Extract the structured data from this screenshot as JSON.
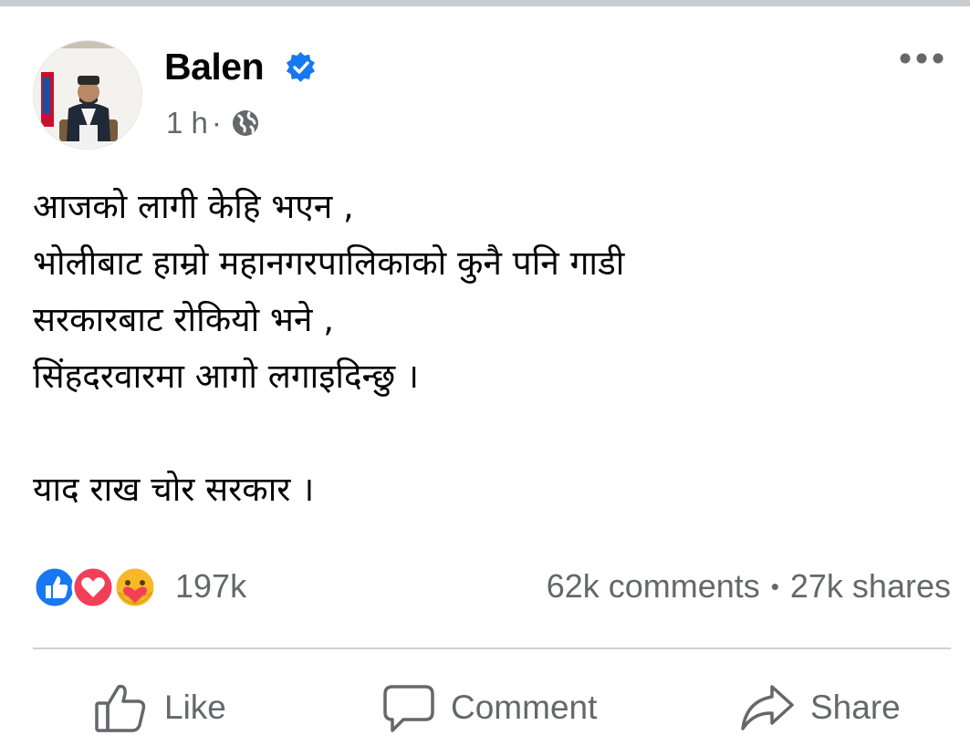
{
  "post": {
    "author": "Balen",
    "time": "1 h",
    "meta_separator": "·",
    "audience_icon": "globe-icon",
    "verified_color": "#1877f2",
    "text_lines": [
      "आजको लागी केहि भएन ,",
      "भोलीबाट हाम्रो महानगरपालिकाको कुनै पनि गाडी",
      "सरकारबाट रोकियो भने ,",
      "सिंहदरवारमा आगो लगाइदिन्छु ।",
      "याद राख चोर सरकार ।"
    ]
  },
  "stats": {
    "reactions_count": "197k",
    "comments": "62k comments",
    "separator": "•",
    "shares": "27k shares",
    "reaction_icons": [
      "like-reaction-icon",
      "love-reaction-icon",
      "care-reaction-icon"
    ]
  },
  "actions": {
    "like": "Like",
    "comment": "Comment",
    "share": "Share"
  },
  "colors": {
    "muted_text": "#65676b",
    "like_blue": "#1877f2",
    "love_red": "#f33e58",
    "care_yellow": "#f7b928"
  }
}
